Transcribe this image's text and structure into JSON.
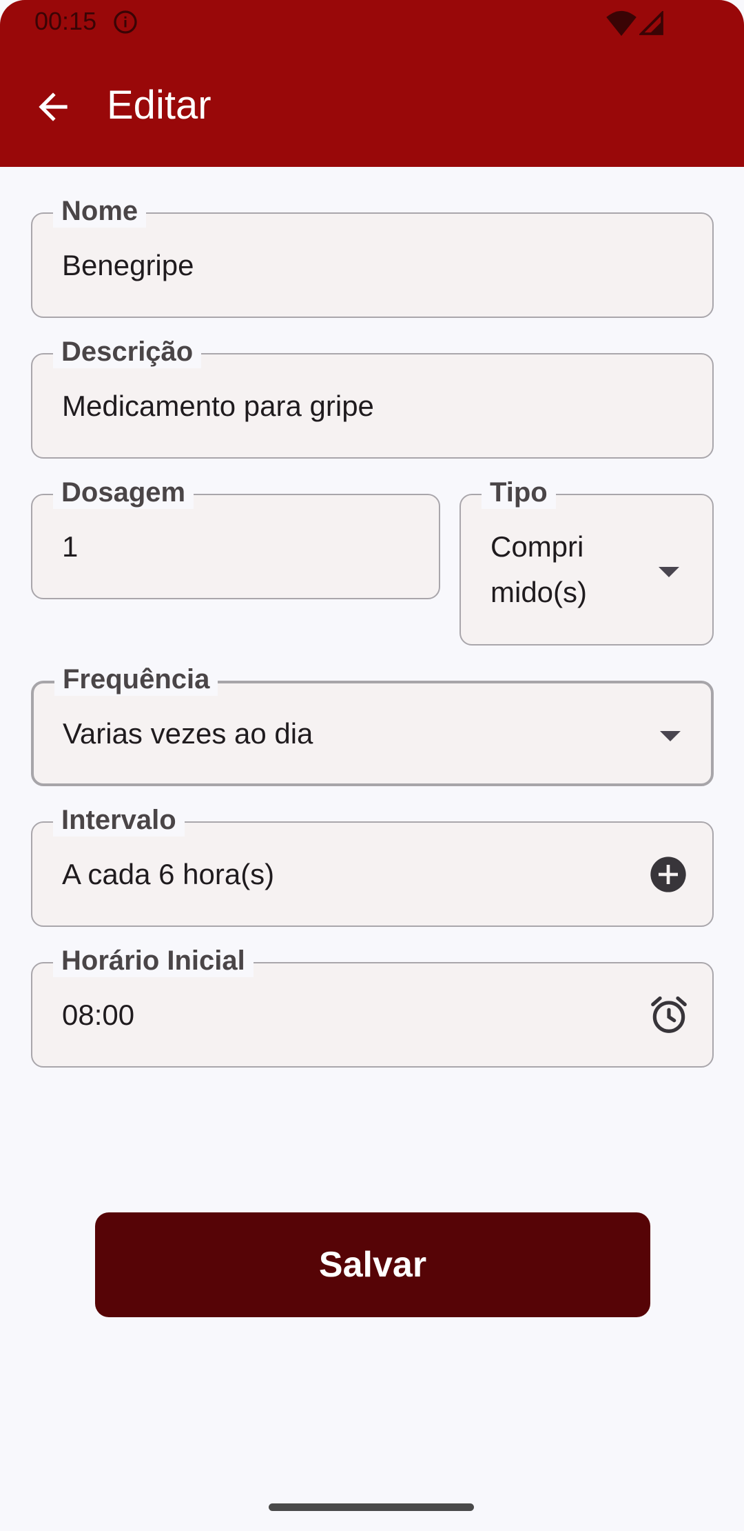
{
  "status_bar": {
    "time": "00:15"
  },
  "header": {
    "title": "Editar"
  },
  "form": {
    "nome": {
      "label": "Nome",
      "value": "Benegripe"
    },
    "descricao": {
      "label": "Descrição",
      "value": "Medicamento para gripe"
    },
    "dosagem": {
      "label": "Dosagem",
      "value": "1"
    },
    "tipo": {
      "label": "Tipo",
      "value_line1": "Compri",
      "value_line2": "mido(s)"
    },
    "frequencia": {
      "label": "Frequência",
      "value": "Varias vezes ao dia"
    },
    "intervalo": {
      "label": "Intervalo",
      "value": "A cada 6 hora(s)"
    },
    "horario_inicial": {
      "label": "Horário Inicial",
      "value": "08:00"
    }
  },
  "actions": {
    "save_label": "Salvar"
  },
  "icons": {
    "status_info": "info-icon",
    "wifi": "wifi-icon",
    "signal": "signal-icon",
    "back": "arrow-back-icon",
    "dropdown": "arrow-drop-down-icon",
    "add": "add-circle-icon",
    "alarm": "alarm-icon"
  },
  "colors": {
    "appbar": "#990809",
    "save_button": "#560406",
    "field_background": "#f6f2f2",
    "page_background": "#f8f8fc"
  }
}
